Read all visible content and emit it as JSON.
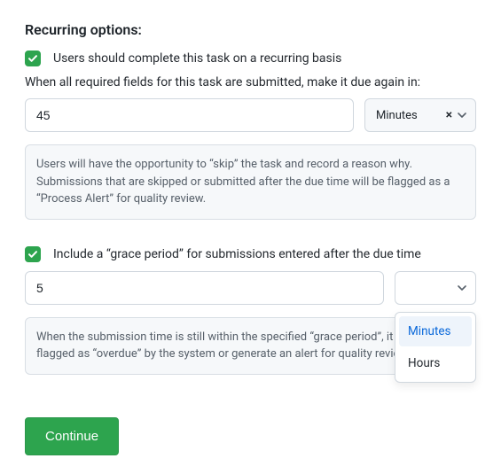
{
  "title": "Recurring options:",
  "recurring": {
    "checkbox_label": "Users should complete this task on a recurring basis",
    "field_label": "When all required fields for this task are submitted, make it due again in:",
    "value": "45",
    "unit_selected": "Minutes",
    "note": "Users will have the opportunity to “skip” the task and record a reason why. Submissions that are skipped or submitted after the due time will be flagged as a “Process Alert” for quality review."
  },
  "grace": {
    "checkbox_label": "Include a “grace period” for submissions entered after the due time",
    "value": "5",
    "note": "When the submission time is still within the specified “grace period”, it will not be flagged as “overdue” by the system or generate an alert for quality review.",
    "dropdown": {
      "options": [
        "Minutes",
        "Hours"
      ],
      "selected": "Minutes"
    }
  },
  "continue_label": "Continue"
}
